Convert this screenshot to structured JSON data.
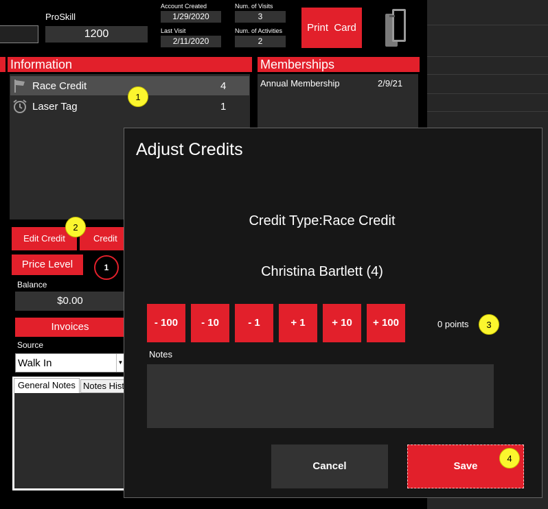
{
  "header": {
    "proskill_label": "ProSkill",
    "proskill_value": "1200",
    "account_created_label": "Account Created",
    "account_created_value": "1/29/2020",
    "visits_label": "Num. of Visits",
    "visits_value": "3",
    "last_visit_label": "Last Visit",
    "last_visit_value": "2/11/2020",
    "activities_label": "Num. of Activities",
    "activities_value": "2",
    "print_card_label": "Print  Card"
  },
  "information": {
    "title": "Information",
    "items": [
      {
        "icon": "flag-icon",
        "label": "Race Credit",
        "value": "4"
      },
      {
        "icon": "alarm-clock-icon",
        "label": "Laser Tag",
        "value": "1"
      }
    ]
  },
  "memberships": {
    "title": "Memberships",
    "items": [
      {
        "label": "Annual Membership",
        "date": "2/9/21"
      }
    ]
  },
  "left_panel": {
    "edit_credit": "Edit Credit",
    "credit_history": "Credit Hi",
    "price_level": "Price Level",
    "price_badge": "1",
    "balance_label": "Balance",
    "balance_value": "$0.00",
    "invoices": "Invoices",
    "source_label": "Source",
    "source_value": "Walk In",
    "tab_general": "General Notes",
    "tab_history": "Notes Hist"
  },
  "dialog": {
    "title": "Adjust Credits",
    "credit_type": "Credit Type:Race Credit",
    "customer": "Christina Bartlett (4)",
    "adjust_buttons": [
      "- 100",
      "- 10",
      "- 1",
      "+ 1",
      "+ 10",
      "+ 100"
    ],
    "points": "0 points",
    "notes_label": "Notes",
    "notes_value": "",
    "cancel": "Cancel",
    "save": "Save"
  },
  "annotations": [
    "1",
    "2",
    "3",
    "4"
  ],
  "colors": {
    "accent": "#e2202b",
    "badge": "#fbf62e",
    "panel": "#2b2b2b",
    "dialog": "#171717"
  }
}
